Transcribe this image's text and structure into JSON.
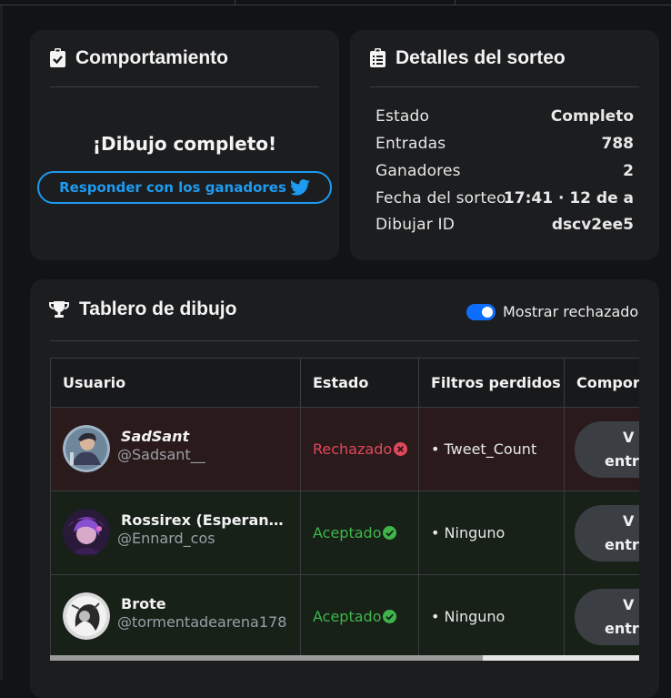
{
  "behavior": {
    "title": "Comportamiento",
    "message": "¡Dibujo completo!",
    "reply_button": "Responder con los ganadores"
  },
  "details": {
    "title": "Detalles del sorteo",
    "rows": [
      {
        "key": "Estado",
        "value": "Completo"
      },
      {
        "key": "Entradas",
        "value": "788"
      },
      {
        "key": "Ganadores",
        "value": "2"
      },
      {
        "key": "Fecha del sorteo",
        "value": "17:41 · 12 de a"
      },
      {
        "key": "Dibujar ID",
        "value": "dscv2ee5"
      }
    ]
  },
  "board": {
    "title": "Tablero de dibujo",
    "toggle_label": "Mostrar rechazado",
    "toggle_on": true,
    "columns": [
      "Usuario",
      "Estado",
      "Filtros perdidos",
      "Comport"
    ],
    "rows": [
      {
        "name": "SadSant",
        "handle": "@Sadsant__",
        "status": "Rechazado",
        "status_kind": "rejected",
        "filters": "• Tweet_Count",
        "action_line1": "V",
        "action_line2": "entr"
      },
      {
        "name": "Rossirex (Esperando...",
        "handle": "@Ennard_cos",
        "status": "Aceptado",
        "status_kind": "accepted",
        "filters": "• Ninguno",
        "action_line1": "V",
        "action_line2": "entr"
      },
      {
        "name": "Brote",
        "handle": "@tormentadearena178",
        "status": "Aceptado",
        "status_kind": "accepted",
        "filters": "• Ninguno",
        "action_line1": "V",
        "action_line2": "entr"
      }
    ]
  },
  "colors": {
    "accent_blue": "#1d9bf0",
    "rejected": "#e0485a",
    "accepted": "#3fb44a",
    "toggle": "#0d6efd"
  },
  "icons": [
    "clipboard-check-icon",
    "clipboard-list-icon",
    "trophy-icon",
    "twitter-icon",
    "x-circle-icon",
    "check-circle-icon"
  ]
}
